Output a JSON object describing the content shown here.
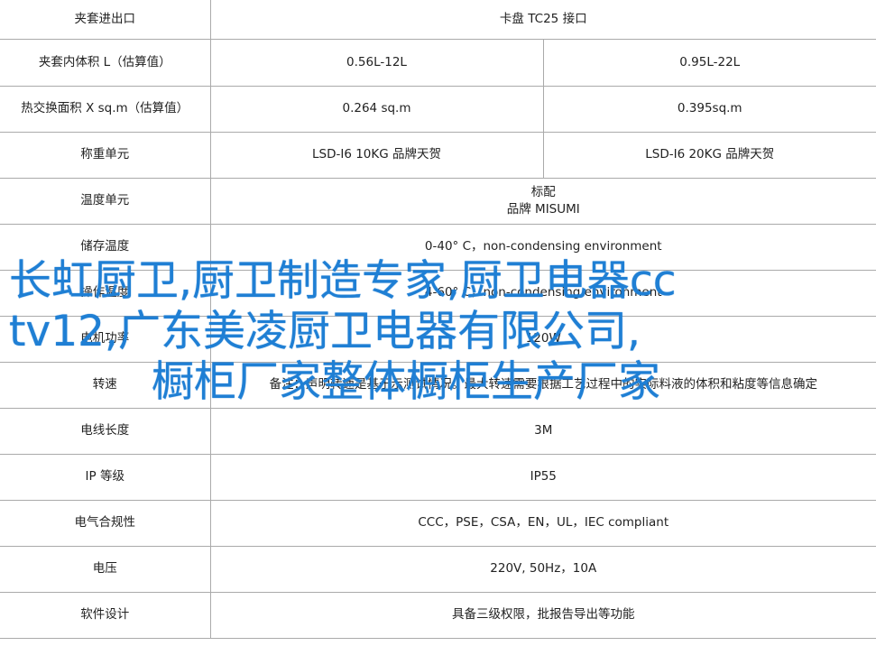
{
  "rows": [
    {
      "label": "夹套进出口",
      "merged": "卡盘 TC25 接口"
    },
    {
      "label": "夹套内体积 L（估算值）",
      "a": "0.56L-12L",
      "b": "0.95L-22L"
    },
    {
      "label": "热交换面积 X sq.m（估算值）",
      "a": "0.264 sq.m",
      "b": "0.395sq.m"
    },
    {
      "label": "称重单元",
      "a": "LSD-I6 10KG 品牌天贺",
      "b": "LSD-I6 20KG 品牌天贺"
    },
    {
      "label": "温度单元",
      "merged_line1": "标配",
      "merged_line2": "品牌 MISUMI"
    },
    {
      "label": "储存温度",
      "merged": "0-40° C，non-condensing environment"
    },
    {
      "label": "操作温度",
      "merged": "4-60° C，non-condensing environment"
    },
    {
      "label": "电机功率",
      "merged": "120W"
    },
    {
      "label": "转速",
      "merged": "备注：声明转速是基于示测试情况。最大转速需要根据工艺过程中的实际料液的体积和粘度等信息确定"
    },
    {
      "label": "电线长度",
      "merged": "3M"
    },
    {
      "label": "IP 等级",
      "merged": "IP55"
    },
    {
      "label": "电气合规性",
      "merged": "CCC，PSE，CSA，EN，UL，IEC compliant"
    },
    {
      "label": "电压",
      "merged": "220V, 50Hz，10A"
    },
    {
      "label": "软件设计",
      "merged": "具备三级权限，批报告导出等功能"
    }
  ],
  "watermark": {
    "line1": "长虹厨卫,厨卫制造专家,厨卫电器cc",
    "line2": "tv12,广东美凌厨卫电器有限公司,",
    "line3": "橱柜厂家整体橱柜生产厂家",
    "color": "#1f7fd4"
  }
}
